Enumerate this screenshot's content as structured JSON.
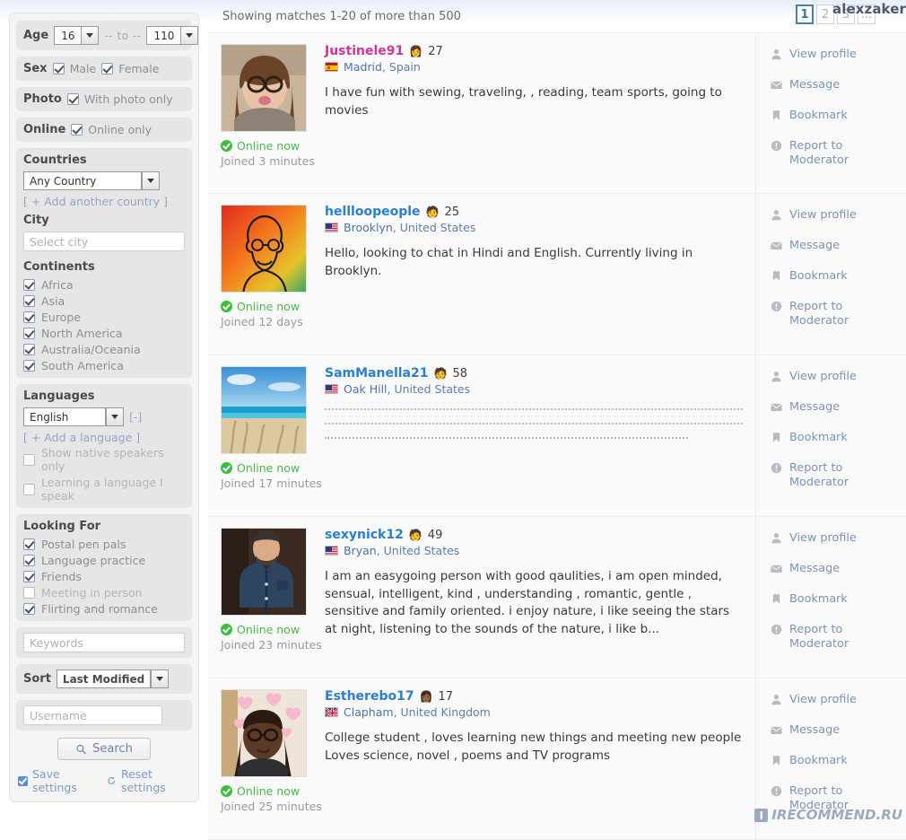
{
  "sidebar": {
    "age": {
      "label": "Age",
      "min": "16",
      "separator": "-- to --",
      "max": "110"
    },
    "sex": {
      "label": "Sex",
      "male": "Male",
      "female": "Female"
    },
    "photo": {
      "label": "Photo",
      "option": "With photo only"
    },
    "online": {
      "label": "Online",
      "option": "Online only"
    },
    "countries": {
      "title": "Countries",
      "selected": "Any Country",
      "add_link": "[ + Add another country ]"
    },
    "city": {
      "title": "City",
      "placeholder": "Select city",
      "value": ""
    },
    "continents": {
      "title": "Continents",
      "items": [
        {
          "label": "Africa",
          "checked": true
        },
        {
          "label": "Asia",
          "checked": true
        },
        {
          "label": "Europe",
          "checked": true
        },
        {
          "label": "North America",
          "checked": true
        },
        {
          "label": "Australia/Oceania",
          "checked": true
        },
        {
          "label": "South America",
          "checked": true
        }
      ]
    },
    "languages": {
      "title": "Languages",
      "selected": "English",
      "minus": "[-]",
      "add_link": "[ + Add a language ]",
      "items": [
        {
          "label": "Show native speakers only",
          "checked": false
        },
        {
          "label": "Learning a language I speak",
          "checked": false
        }
      ]
    },
    "looking_for": {
      "title": "Looking For",
      "items": [
        {
          "label": "Postal pen pals",
          "checked": true
        },
        {
          "label": "Language practice",
          "checked": true
        },
        {
          "label": "Friends",
          "checked": true
        },
        {
          "label": "Meeting in person",
          "checked": false
        },
        {
          "label": "Flirting and romance",
          "checked": true
        }
      ]
    },
    "keywords": {
      "placeholder": "Keywords",
      "value": ""
    },
    "sort": {
      "label": "Sort",
      "selected": "Last Modified"
    },
    "username": {
      "placeholder": "Username",
      "value": ""
    },
    "search_button": "Search",
    "save_settings": "Save settings",
    "reset_settings": "Reset settings"
  },
  "results_header": {
    "count_text": "Showing matches 1-20 of more than 500",
    "pages": [
      "1",
      "2",
      "3",
      "..."
    ],
    "active_page": "1"
  },
  "watermarks": {
    "top": "alexzaker",
    "bottom": "IRECOMMEND.RU",
    "bottom_badge": "I"
  },
  "actions": {
    "view_profile": "View profile",
    "message": "Message",
    "bookmark": "Bookmark",
    "report": "Report to Moderator"
  },
  "profiles": [
    {
      "username": "Justinele91",
      "username_color": "#d2359a",
      "age": "27",
      "face": "👩",
      "city": "Madrid",
      "country": "Spain",
      "flag": "spain",
      "status": "Online now",
      "joined": "Joined 3 minutes",
      "blurb": "I have fun with sewing, traveling, , reading, team sports, going to movies",
      "blurb_type": "text",
      "photo": "woman-glasses-portrait"
    },
    {
      "username": "hellloopeople",
      "username_color": "#2a7fd4",
      "age": "25",
      "face": "🧑",
      "city": "Brooklyn",
      "country": "United States",
      "flag": "usa",
      "status": "Online now",
      "joined": "Joined 12 days",
      "blurb": "Hello, looking to chat in Hindi and English. Currently living in Brooklyn.",
      "blurb_type": "text",
      "photo": "illustrated-avatar-orange"
    },
    {
      "username": "SamManella21",
      "username_color": "#2a7fd4",
      "age": "58",
      "face": "🧑",
      "city": "Oak Hill",
      "country": "United States",
      "flag": "usa",
      "status": "Online now",
      "joined": "Joined 17 minutes",
      "blurb": "",
      "blurb_type": "dotted",
      "photo": "beach-landscape"
    },
    {
      "username": "sexynick12",
      "username_color": "#2a7fd4",
      "age": "49",
      "face": "🧑",
      "city": "Bryan",
      "country": "United States",
      "flag": "usa",
      "status": "Online now",
      "joined": "Joined 23 minutes",
      "blurb": "I am an easygoing person with good qaulities, i am open minded, sensual, intelligent, kind , understanding , romantic, gentle , sensitive and family oriented. i enjoy nature, i like seeing the stars at night, listening to the sounds of the nature, i like b...",
      "blurb_type": "text",
      "photo": "man-blue-shirt"
    },
    {
      "username": "Estherebo17",
      "username_color": "#2a7fd4",
      "age": "17",
      "face": "👩🏾",
      "city": "Clapham",
      "country": "United Kingdom",
      "flag": "uk",
      "status": "Online now",
      "joined": "Joined 25 minutes",
      "blurb": "College student , loves learning new things and meeting new people Loves science, novel , poems and TV programs",
      "blurb_type": "text",
      "photo": "woman-hearts-background"
    }
  ]
}
